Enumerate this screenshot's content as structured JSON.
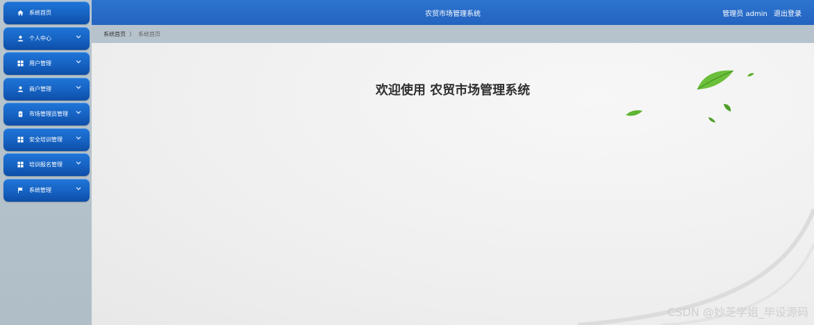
{
  "sidebar": {
    "items": [
      {
        "label": "系统首页",
        "icon": "home-icon",
        "chevron": false
      },
      {
        "label": "个人中心",
        "icon": "user-icon",
        "chevron": true
      },
      {
        "label": "用户管理",
        "icon": "grid-icon",
        "chevron": true
      },
      {
        "label": "商户管理",
        "icon": "user-icon",
        "chevron": true
      },
      {
        "label": "市场管理员管理",
        "icon": "clipboard-icon",
        "chevron": true
      },
      {
        "label": "安全培训管理",
        "icon": "grid-icon",
        "chevron": true
      },
      {
        "label": "培训报名管理",
        "icon": "grid-icon",
        "chevron": true
      },
      {
        "label": "系统管理",
        "icon": "flag-icon",
        "chevron": true
      }
    ]
  },
  "header": {
    "title": "农贸市场管理系统",
    "user_label": "管理员 admin",
    "logout_label": "退出登录"
  },
  "breadcrumb": {
    "root": "系统首页",
    "separator": "〉",
    "current": "系统首页"
  },
  "main": {
    "welcome": "欢迎使用 农贸市场管理系统"
  },
  "watermark": "CSDN @妙芝学姐_毕设源码",
  "colors": {
    "accent": "#1f6fd0",
    "sidebar_bg": "#b6c3cd",
    "leaf": "#6bbf3a"
  }
}
